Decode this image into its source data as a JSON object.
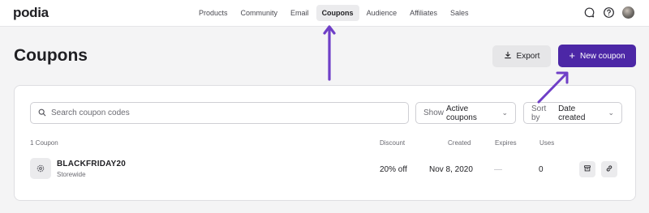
{
  "brand": {
    "logo_text": "podia"
  },
  "nav": {
    "items": [
      {
        "label": "Products"
      },
      {
        "label": "Community"
      },
      {
        "label": "Email"
      },
      {
        "label": "Coupons",
        "active": true
      },
      {
        "label": "Audience"
      },
      {
        "label": "Affiliates"
      },
      {
        "label": "Sales"
      }
    ]
  },
  "header_icons": [
    "chat-icon",
    "help-icon",
    "avatar"
  ],
  "page": {
    "title": "Coupons",
    "export_label": "Export",
    "new_label": "New coupon"
  },
  "filters": {
    "search_placeholder": "Search coupon codes",
    "show_label": "Show",
    "show_value": "Active coupons",
    "sort_label": "Sort by",
    "sort_value": "Date created"
  },
  "table": {
    "count_label": "1 Coupon",
    "headers": {
      "discount": "Discount",
      "created": "Created",
      "expires": "Expires",
      "uses": "Uses"
    },
    "rows": [
      {
        "code": "BLACKFRIDAY20",
        "scope": "Storewide",
        "discount": "20% off",
        "created": "Nov 8, 2020",
        "expires": "—",
        "uses": "0"
      }
    ]
  },
  "colors": {
    "accent": "#4c27a6",
    "arrow": "#6f3fc7"
  }
}
